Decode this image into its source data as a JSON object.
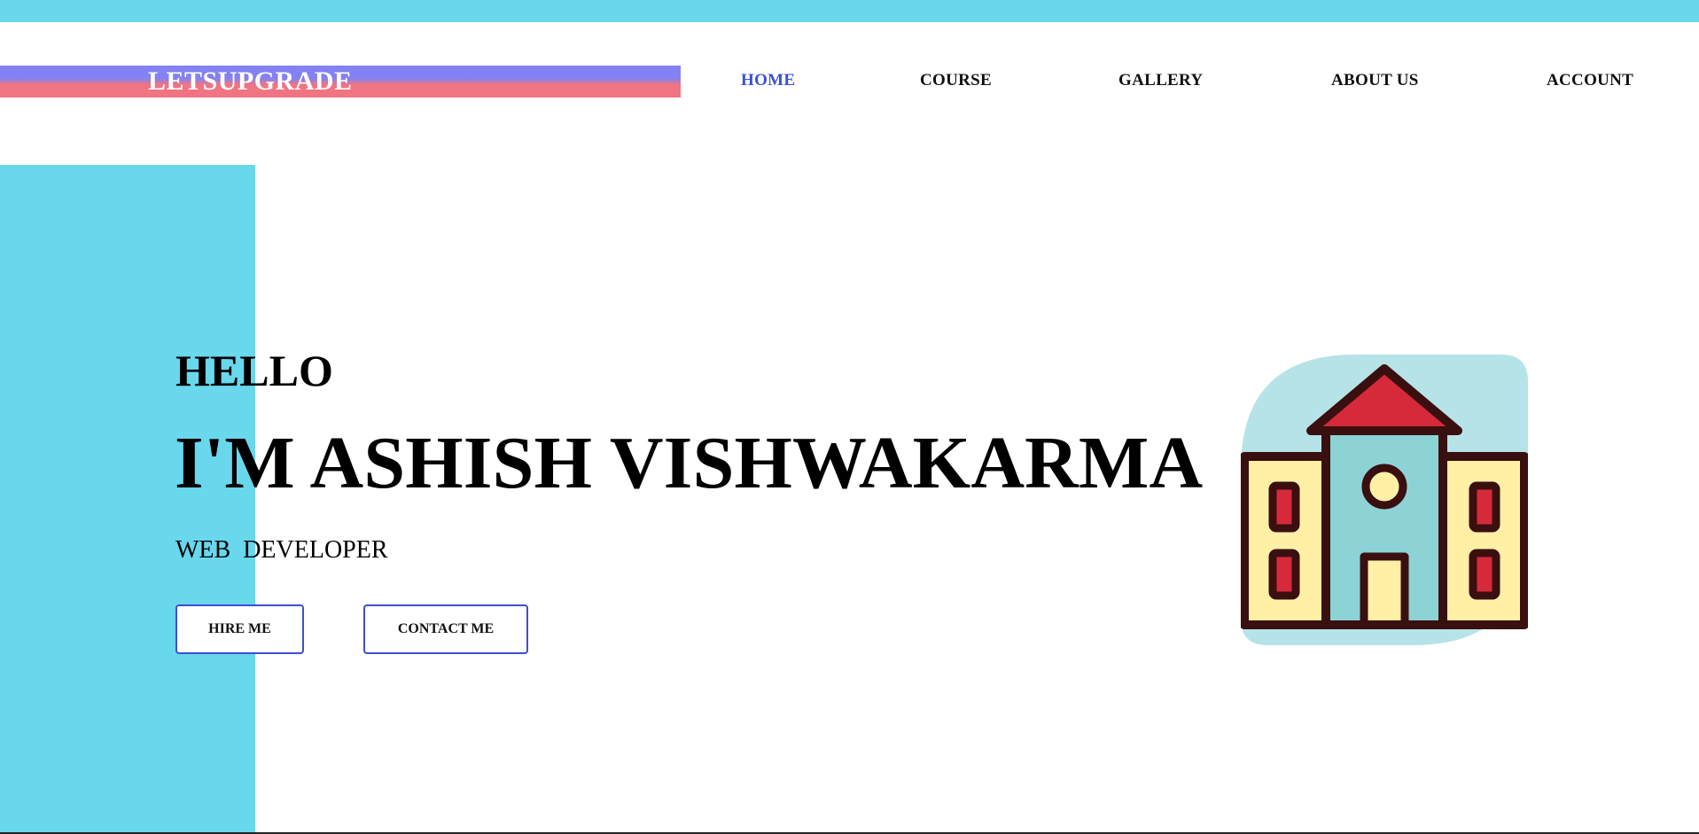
{
  "brand": {
    "logo": "LETSUPGRADE"
  },
  "nav": {
    "items": [
      {
        "label": "HOME",
        "active": true
      },
      {
        "label": "COURSE",
        "active": false
      },
      {
        "label": "GALLERY",
        "active": false
      },
      {
        "label": "ABOUT US",
        "active": false
      },
      {
        "label": "ACCOUNT",
        "active": false
      }
    ]
  },
  "hero": {
    "greeting": "HELLO",
    "name": "I'M ASHISH VISHWAKARMA",
    "role": "WEB  DEVELOPER",
    "buttons": {
      "hire": "HIRE ME",
      "contact": "CONTACT ME"
    },
    "illustration_icon": "school-building-icon"
  },
  "colors": {
    "accent_cyan": "#69d7ec",
    "nav_active": "#3b50d4",
    "logo_top": "#8282f4",
    "logo_bottom": "#f07482",
    "button_border": "#3b50d4"
  }
}
